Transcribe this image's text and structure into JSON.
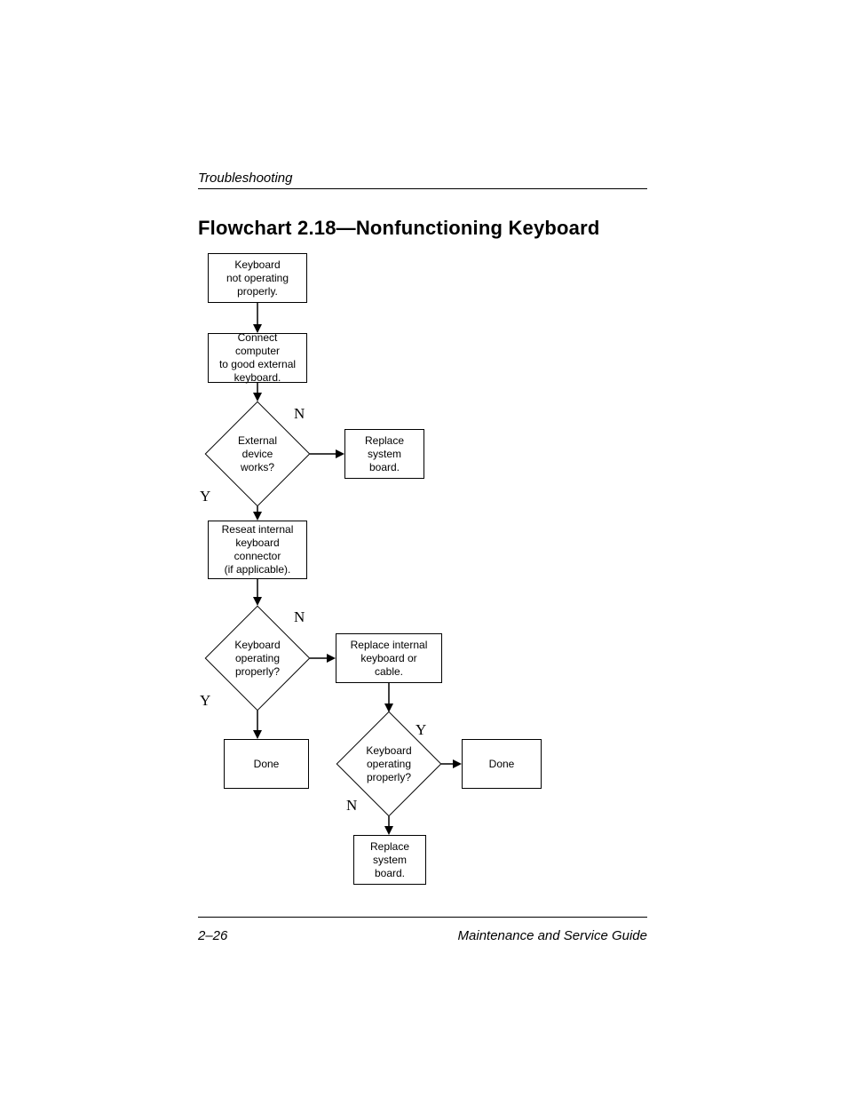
{
  "header": "Troubleshooting",
  "title": "Flowchart 2.18—Nonfunctioning Keyboard",
  "footer_left": "2–26",
  "footer_right": "Maintenance and Service Guide",
  "boxes": {
    "start": "Keyboard\nnot operating\nproperly.",
    "connect": "Connect computer\nto good external\nkeyboard.",
    "replace_sb1": "Replace\nsystem\nboard.",
    "reseat": "Reseat internal\nkeyboard\nconnector\n(if applicable).",
    "replace_kbd": "Replace internal\nkeyboard or\ncable.",
    "done1": "Done",
    "done2": "Done",
    "replace_sb2": "Replace\nsystem\nboard."
  },
  "diamonds": {
    "d1": "External\ndevice\nworks?",
    "d2": "Keyboard\noperating\nproperly?",
    "d3": "Keyboard\noperating\nproperly?"
  },
  "labels": {
    "n1": "N",
    "y1": "Y",
    "n2": "N",
    "y2": "Y",
    "y3": "Y",
    "n3": "N"
  }
}
